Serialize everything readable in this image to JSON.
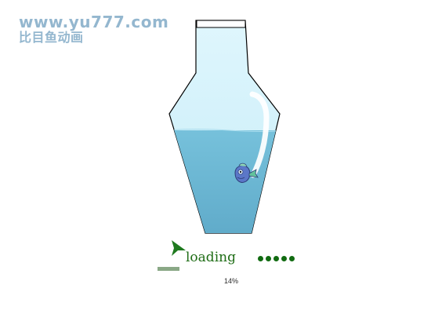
{
  "watermark": {
    "url": "www.yu777.com",
    "subtitle": "比目鱼动画"
  },
  "loader": {
    "label": "loading",
    "percent_text": "14%",
    "progress": 0.14,
    "dot_count": 5,
    "arrow_icon": "green-arrow-icon",
    "fish_icon": "fish-icon"
  },
  "colors": {
    "bottle_outline": "#000000",
    "bottle_glass": "#d6f1fb",
    "water": "#6ab7d4",
    "loading_text": "#1f6d16",
    "dots": "#116b11",
    "progress_fill": "#8aa886",
    "watermark": "#8fb4cd"
  }
}
